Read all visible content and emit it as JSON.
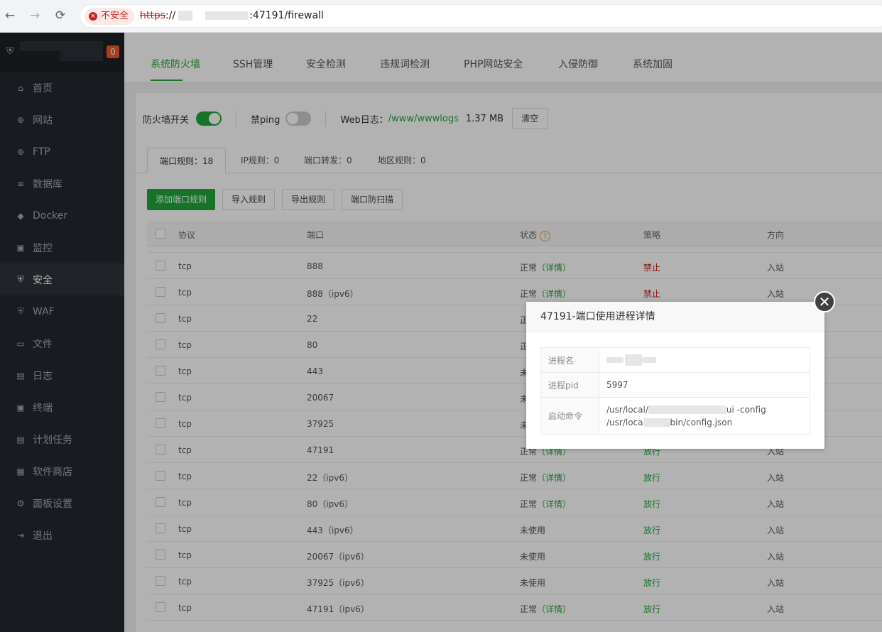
{
  "browser": {
    "back_icon": "←",
    "forward_icon": "→",
    "reload_icon": "⟳",
    "security_label": "不安全",
    "url_scheme": "https",
    "url_sep": "://",
    "url_rest": ":47191/firewall"
  },
  "sidebar": {
    "badge": "0",
    "items": [
      {
        "icon": "⌂",
        "label": "首页"
      },
      {
        "icon": "⊕",
        "label": "网站"
      },
      {
        "icon": "⊕",
        "label": "FTP"
      },
      {
        "icon": "≡",
        "label": "数据库"
      },
      {
        "icon": "◆",
        "label": "Docker"
      },
      {
        "icon": "▣",
        "label": "监控"
      },
      {
        "icon": "⛨",
        "label": "安全"
      },
      {
        "icon": "⛨",
        "label": "WAF"
      },
      {
        "icon": "▭",
        "label": "文件"
      },
      {
        "icon": "▤",
        "label": "日志"
      },
      {
        "icon": "▣",
        "label": "终端"
      },
      {
        "icon": "▤",
        "label": "计划任务"
      },
      {
        "icon": "▦",
        "label": "软件商店"
      },
      {
        "icon": "⚙",
        "label": "面板设置"
      },
      {
        "icon": "⇥",
        "label": "退出"
      }
    ]
  },
  "tabs": [
    "系统防火墙",
    "SSH管理",
    "安全检测",
    "违规词检测",
    "PHP网站安全",
    "入侵防御",
    "系统加固"
  ],
  "toolbar": {
    "firewall_label": "防火墙开关",
    "ping_label": "禁ping",
    "weblog_label": "Web日志：",
    "weblog_path": "/www/wwwlogs",
    "weblog_size": "1.37 MB",
    "clear_button": "清空"
  },
  "subtabs": [
    "端口规则：18",
    "IP规则：0",
    "端口转发：0",
    "地区规则：0"
  ],
  "actions": [
    "添加端口规则",
    "导入规则",
    "导出规则",
    "端口防扫描"
  ],
  "table": {
    "headers": [
      "协议",
      "端口",
      "状态",
      "策略",
      "方向"
    ],
    "help_icon": "?",
    "rows": [
      {
        "proto": "tcp",
        "port": "888",
        "status": "正常",
        "detail": "（详情）",
        "policy": "禁止",
        "dir": "入站"
      },
      {
        "proto": "tcp",
        "port": "888（ipv6）",
        "status": "正常",
        "detail": "（详情）",
        "policy": "禁止",
        "dir": "入站"
      },
      {
        "proto": "tcp",
        "port": "22",
        "status": "正",
        "detail": "",
        "policy": "",
        "dir": ""
      },
      {
        "proto": "tcp",
        "port": "80",
        "status": "正",
        "detail": "",
        "policy": "",
        "dir": ""
      },
      {
        "proto": "tcp",
        "port": "443",
        "status": "未",
        "detail": "",
        "policy": "",
        "dir": ""
      },
      {
        "proto": "tcp",
        "port": "20067",
        "status": "未",
        "detail": "",
        "policy": "",
        "dir": ""
      },
      {
        "proto": "tcp",
        "port": "37925",
        "status": "未",
        "detail": "",
        "policy": "",
        "dir": ""
      },
      {
        "proto": "tcp",
        "port": "47191",
        "status": "正常",
        "detail": "（详情）",
        "policy": "放行",
        "dir": "入站"
      },
      {
        "proto": "tcp",
        "port": "22（ipv6）",
        "status": "正常",
        "detail": "（详情）",
        "policy": "放行",
        "dir": "入站"
      },
      {
        "proto": "tcp",
        "port": "80（ipv6）",
        "status": "正常",
        "detail": "（详情）",
        "policy": "放行",
        "dir": "入站"
      },
      {
        "proto": "tcp",
        "port": "443（ipv6）",
        "status": "未使用",
        "detail": "",
        "policy": "放行",
        "dir": "入站"
      },
      {
        "proto": "tcp",
        "port": "20067（ipv6）",
        "status": "未使用",
        "detail": "",
        "policy": "放行",
        "dir": "入站"
      },
      {
        "proto": "tcp",
        "port": "37925（ipv6）",
        "status": "未使用",
        "detail": "",
        "policy": "放行",
        "dir": "入站"
      },
      {
        "proto": "tcp",
        "port": "47191（ipv6）",
        "status": "正常",
        "detail": "（详情）",
        "policy": "放行",
        "dir": "入站"
      }
    ]
  },
  "dialog": {
    "title": "47191-端口使用进程详情",
    "close_icon": "✕",
    "rows": [
      {
        "key": "进程名",
        "value": ""
      },
      {
        "key": "进程pid",
        "value": "5997"
      },
      {
        "key": "启动命令",
        "line1a": "/usr/local/",
        "line1b": "ui -config",
        "line2a": "/usr/loca",
        "line2b": "bin/config.json"
      }
    ]
  },
  "colors": {
    "accent": "#20a53a",
    "deny": "#c81414",
    "sidebar": "#23272e",
    "badge": "#f0592a"
  }
}
